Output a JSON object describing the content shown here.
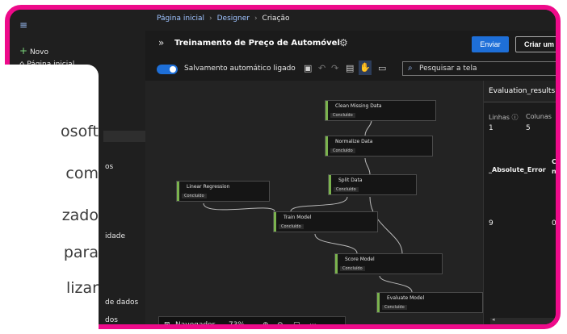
{
  "breadcrumb": {
    "home": "Página inicial",
    "designer": "Designer",
    "current": "Criação"
  },
  "nav": {
    "menu_icon": "hamburger-icon",
    "new": "Novo",
    "home": "Página inicial",
    "visible_fragments": [
      "os",
      "idade",
      "de dados",
      "dos"
    ]
  },
  "pipeline": {
    "title": "Treinamento de Preço de Automóvel",
    "submit_label": "Enviar",
    "create_label": "Criar um"
  },
  "toolbar": {
    "autosave_label": "Salvamento automático ligado",
    "search_placeholder": "Pesquisar a tela"
  },
  "nodes": [
    {
      "name": "Clean Missing Data",
      "status": "Concluído"
    },
    {
      "name": "Normalize Data",
      "status": "Concluído"
    },
    {
      "name": "Split Data",
      "status": "Concluído"
    },
    {
      "name": "Linear Regression",
      "status": "Concluído"
    },
    {
      "name": "Train Model",
      "status": "Concluído"
    },
    {
      "name": "Score Model",
      "status": "Concluído"
    },
    {
      "name": "Evaluate Model",
      "status": "Concluído"
    }
  ],
  "navigator": {
    "label": "Navegador",
    "zoom": "73%"
  },
  "results": {
    "title": "Evaluation_results",
    "rows_label": "Linhas",
    "rows_value": "1",
    "cols_label": "Colunas",
    "cols_value": "5",
    "column_header": "_Absolute_Error",
    "column_header_2": "C",
    "column_header_2b": "n",
    "cell_value": "9",
    "cell_value_2": "0"
  },
  "overlay_text": [
    "osoft",
    "com",
    "zado",
    "para",
    "lizar"
  ],
  "colors": {
    "frame": "#ee0a8a",
    "accent": "#1e6fd8",
    "status_bar": "#7bb34e"
  }
}
